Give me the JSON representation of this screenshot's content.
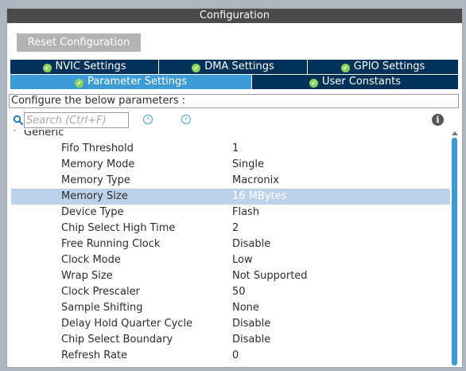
{
  "window": {
    "title": "Configuration"
  },
  "toolbar": {
    "reset_label": "Reset Configuration"
  },
  "tabs_row1": [
    {
      "label": "NVIC Settings"
    },
    {
      "label": "DMA Settings"
    },
    {
      "label": "GPIO Settings"
    }
  ],
  "tabs_row2": [
    {
      "label": "Parameter Settings",
      "active": true
    },
    {
      "label": "User Constants"
    }
  ],
  "configure_label": "Configure the below parameters :",
  "search": {
    "placeholder": "Search (Ctrl+F)"
  },
  "group": {
    "label": "Generic"
  },
  "parameters": [
    {
      "name": "Fifo Threshold",
      "value": "1"
    },
    {
      "name": "Memory Mode",
      "value": "Single"
    },
    {
      "name": "Memory Type",
      "value": "Macronix"
    },
    {
      "name": "Memory Size",
      "value": "16 MBytes",
      "selected": true
    },
    {
      "name": "Device Type",
      "value": "Flash"
    },
    {
      "name": "Chip Select High Time",
      "value": "2"
    },
    {
      "name": "Free Running Clock",
      "value": "Disable"
    },
    {
      "name": "Clock Mode",
      "value": "Low"
    },
    {
      "name": "Wrap Size",
      "value": "Not Supported"
    },
    {
      "name": "Clock Prescaler",
      "value": "50"
    },
    {
      "name": "Sample Shifting",
      "value": "None"
    },
    {
      "name": "Delay Hold Quarter Cycle",
      "value": "Disable"
    },
    {
      "name": "Chip Select Boundary",
      "value": "Disable"
    },
    {
      "name": "Refresh Rate",
      "value": "0"
    }
  ],
  "colors": {
    "active_tab": "#3c9bd4",
    "inactive_tab": "#003159",
    "selected_row": "#bcd2ea",
    "check": "#8bd35a"
  },
  "icons": {
    "search": "search-icon",
    "prev": "chevron-left-icon",
    "next": "chevron-right-icon",
    "info": "info-icon",
    "tab_check": "check-circle-icon"
  }
}
